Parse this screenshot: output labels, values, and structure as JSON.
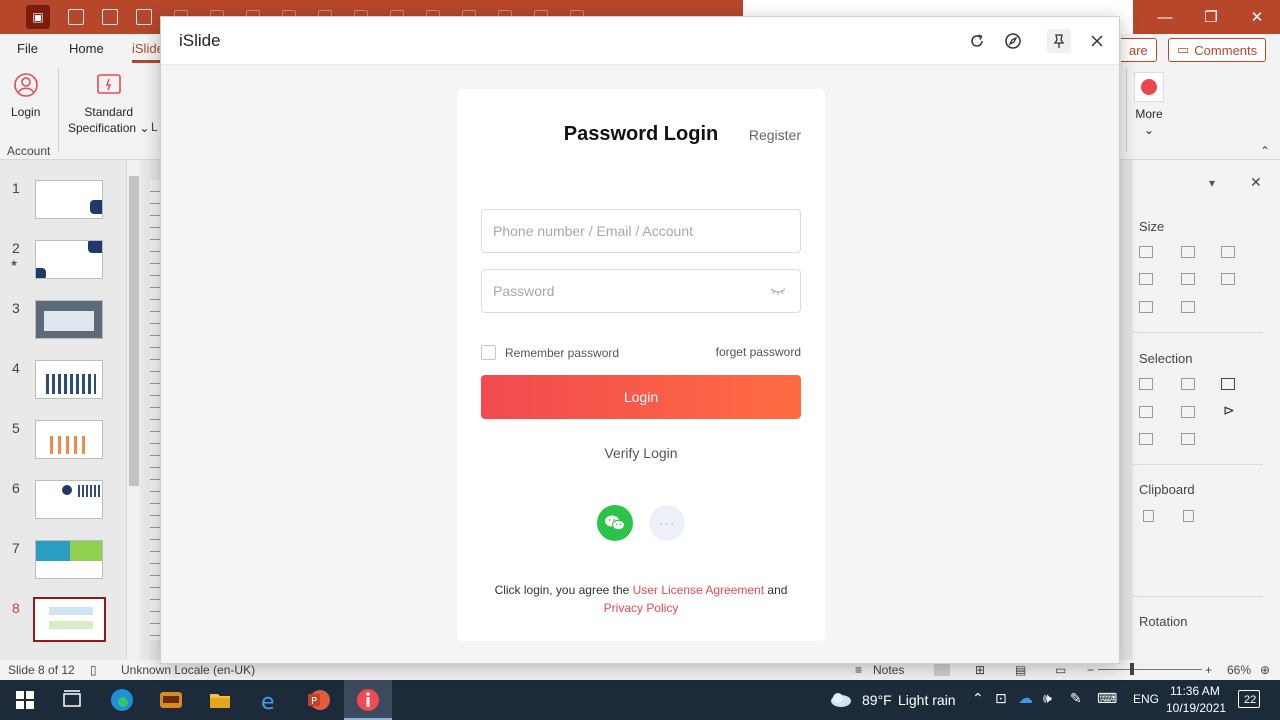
{
  "ppt": {
    "menu": {
      "file": "File",
      "home": "Home",
      "islide": "iSlide",
      "share": "are",
      "comments": "Comments"
    },
    "ribbon": {
      "login": "Login",
      "standard_line1": "Standard",
      "standard_line2": "Specification",
      "account_group": "Account",
      "partial_letter": "L",
      "more": "More"
    },
    "slides": [
      {
        "num": "1"
      },
      {
        "num": "2"
      },
      {
        "num": "3"
      },
      {
        "num": "4"
      },
      {
        "num": "5"
      },
      {
        "num": "6"
      },
      {
        "num": "7"
      },
      {
        "num": "8"
      }
    ],
    "right_pane": {
      "size": "Size",
      "selection": "Selection",
      "clipboard": "Clipboard",
      "rotation": "Rotation"
    },
    "status": {
      "slide_info": "Slide 8 of 12",
      "locale": "Unknown Locale (en-UK)",
      "notes": "Notes",
      "zoom": "66%"
    }
  },
  "taskbar": {
    "weather_temp": "89°F",
    "weather_desc": "Light rain",
    "lang": "ENG",
    "time": "11:36 AM",
    "date": "10/19/2021",
    "notif_count": "22"
  },
  "dialog": {
    "title": "iSlide",
    "heading": "Password Login",
    "register": "Register",
    "account_placeholder": "Phone number / Email / Account",
    "password_placeholder": "Password",
    "remember": "Remember password",
    "forget": "forget password",
    "login_button": "Login",
    "verify_login": "Verify Login",
    "more_dots": "···",
    "agree_prefix": "Click login, you agree the",
    "license_link": "User License Agreement",
    "agree_and": "and",
    "privacy_link": "Privacy Policy",
    "accent_color": "#f24a50",
    "wechat_color": "#2cc34a"
  }
}
